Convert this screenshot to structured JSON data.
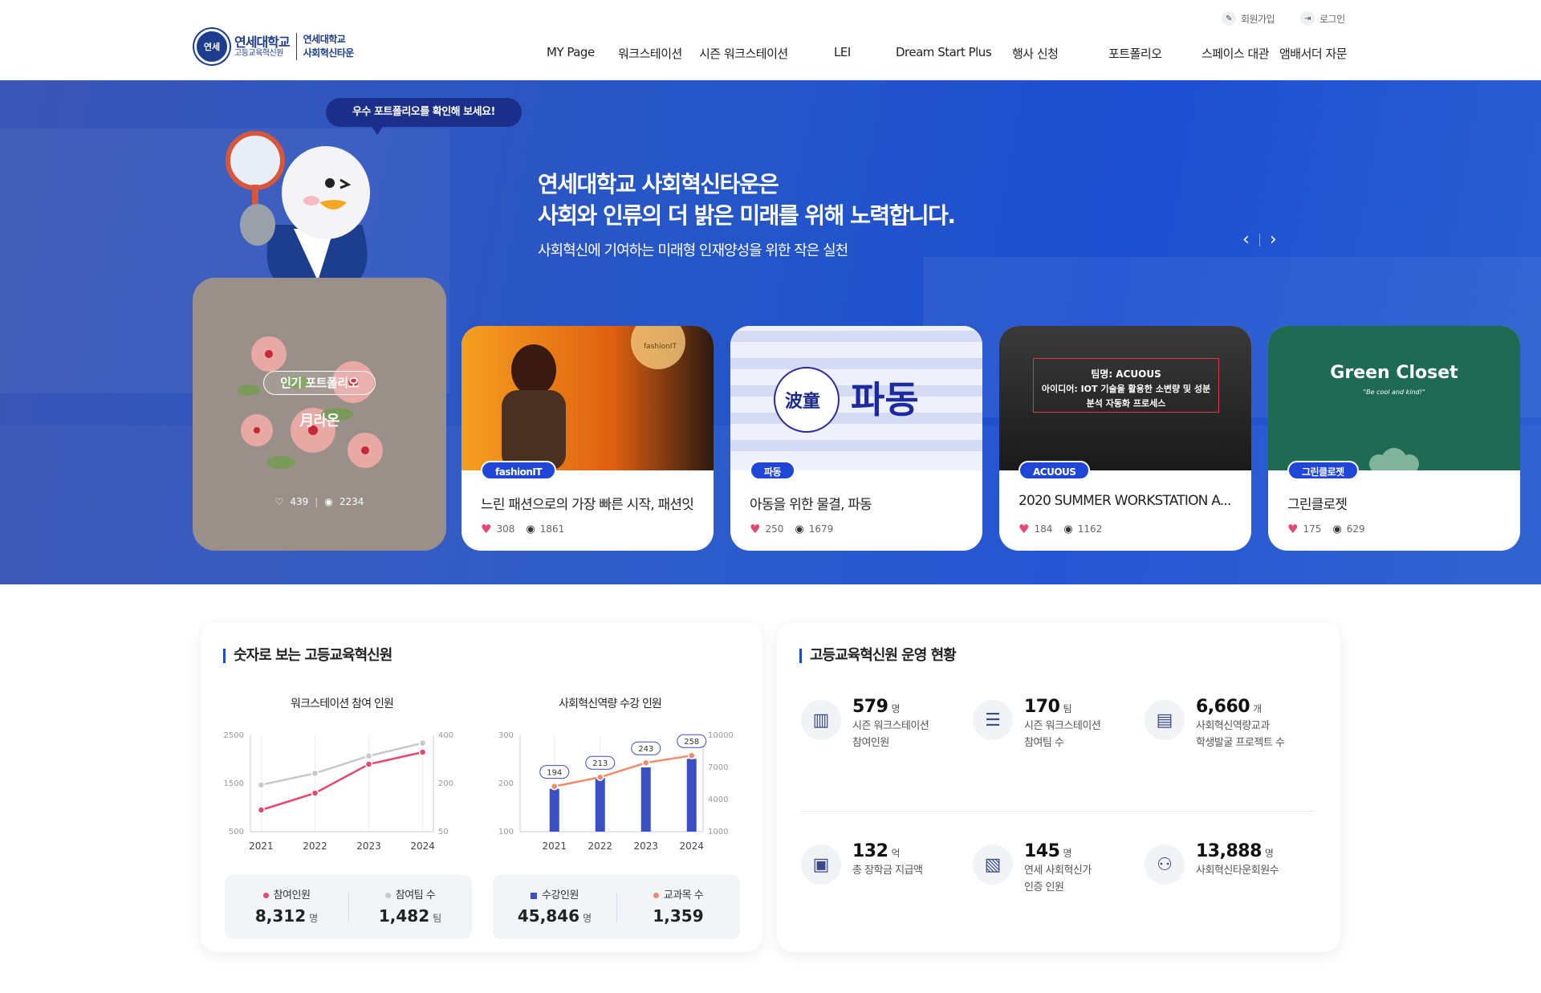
{
  "header": {
    "logo_seal": "연세",
    "logo_main": "연세대학교",
    "logo_sub": "고등교육혁신원",
    "logo_side_line1": "연세대학교",
    "logo_side_line2": "사회혁신타운",
    "util_signup": "회원가입",
    "util_login": "로그인",
    "nav": [
      "MY Page",
      "워크스테이션",
      "시즌 워크스테이션",
      "LEI",
      "Dream Start Plus",
      "행사 신청",
      "포트폴리오",
      "스페이스 대관",
      "앰배서더 자문"
    ]
  },
  "hero": {
    "bubble": "우수 포트폴리오를 확인해 보세요!",
    "headline_line1": "연세대학교 사회혁신타운은",
    "headline_line2": "사회와 인류의 더 밝은 미래를 위해 노력합니다.",
    "subline": "사회혁신에 기여하는 미래형 인재양성을 위한 작은 실천",
    "prev_icon": "chevron-left",
    "next_icon": "chevron-right",
    "popular": {
      "tag": "인기 포트폴리오",
      "title": "月라온",
      "likes": "439",
      "views": "2234"
    },
    "cards": [
      {
        "badge": "fashionIT",
        "title": "느린 패션으로의 가장 빠른 시작, 패션잇",
        "likes": "308",
        "views": "1861",
        "img_text": "fashionIT"
      },
      {
        "badge": "파동",
        "title": "아동을 위한 물결, 파동",
        "likes": "250",
        "views": "1679",
        "img_text": "파동",
        "img_text2": "波童"
      },
      {
        "badge": "ACUOUS",
        "title": "2020 SUMMER WORKSTATION A...",
        "likes": "184",
        "views": "1162",
        "img_text": "팀명: ACUOUS",
        "img_text2": "아이디어: IOT 기술을 활용한 소변량 및 성분 분석 자동화 프로세스"
      },
      {
        "badge": "그린클로젯",
        "title": "그린클로젯",
        "likes": "175",
        "views": "629",
        "img_text": "Green Closet",
        "img_text2": "\"Be cool and kind!\""
      }
    ]
  },
  "stats_panel": {
    "title": "숫자로 보는 고등교육혁신원",
    "chart1": {
      "title": "워크스테이션 참여 인원",
      "legend1": "참여인원",
      "value1": "8,312",
      "unit1": "명",
      "legend2": "참여팀 수",
      "value2": "1,482",
      "unit2": "팀"
    },
    "chart2": {
      "title": "사회혁신역량 수강 인원",
      "legend1": "수강인원",
      "value1": "45,846",
      "unit1": "명",
      "legend2": "교과목 수",
      "value2": "1,359",
      "unit2": ""
    }
  },
  "chart_data": [
    {
      "type": "line",
      "title": "워크스테이션 참여 인원",
      "x": [
        "2021",
        "2022",
        "2023",
        "2024"
      ],
      "y_left_ticks": [
        "2500",
        "1500",
        "500"
      ],
      "y_right_ticks": [
        "400",
        "200",
        "50"
      ],
      "ylim_left": [
        500,
        2500
      ],
      "ylim_right": [
        50,
        400
      ],
      "series": [
        {
          "name": "참여인원",
          "axis": "left",
          "color": "#e8466e",
          "values": [
            950,
            1300,
            1900,
            2150
          ]
        },
        {
          "name": "참여팀 수",
          "axis": "right",
          "color": "#c8c8cc",
          "values": [
            220,
            262,
            325,
            372
          ]
        }
      ]
    },
    {
      "type": "bar",
      "title": "사회혁신역량 수강 인원",
      "categories": [
        "2021",
        "2022",
        "2023",
        "2024"
      ],
      "y_left_ticks": [
        "300",
        "200",
        "100"
      ],
      "y_right_ticks": [
        "10000",
        "7000",
        "4000",
        "1000"
      ],
      "ylim_left": [
        100,
        300
      ],
      "ylim_right": [
        1000,
        10000
      ],
      "series": [
        {
          "name": "수강인원",
          "axis": "right",
          "color": "#3a4fc4",
          "values": [
            5000,
            6000,
            7000,
            7800
          ]
        },
        {
          "name": "교과목 수",
          "axis": "left",
          "color": "#f08a6a",
          "values": [
            194,
            213,
            243,
            258
          ],
          "labels": [
            "194",
            "213",
            "243",
            "258"
          ]
        }
      ]
    }
  ],
  "ops_panel": {
    "title": "고등교육혁신원 운영 현황",
    "items": [
      {
        "num": "579",
        "unit": "명",
        "label1": "시즌 워크스테이션",
        "label2": "참여인원",
        "icon": "building-icon"
      },
      {
        "num": "170",
        "unit": "팀",
        "label1": "시즌 워크스테이션",
        "label2": "참여팀 수",
        "icon": "server-icon"
      },
      {
        "num": "6,660",
        "unit": "개",
        "label1": "사회혁신역량교과",
        "label2": "학생발굴 프로젝트 수",
        "icon": "list-icon"
      },
      {
        "num": "132",
        "unit": "억",
        "label1": "총 장학금 지급액",
        "label2": "",
        "icon": "money-icon"
      },
      {
        "num": "145",
        "unit": "명",
        "label1": "연세 사회혁신가",
        "label2": "인증 인원",
        "icon": "certificate-icon"
      },
      {
        "num": "13,888",
        "unit": "명",
        "label1": "사회혁신타운회원수",
        "label2": "",
        "icon": "network-icon"
      }
    ]
  }
}
